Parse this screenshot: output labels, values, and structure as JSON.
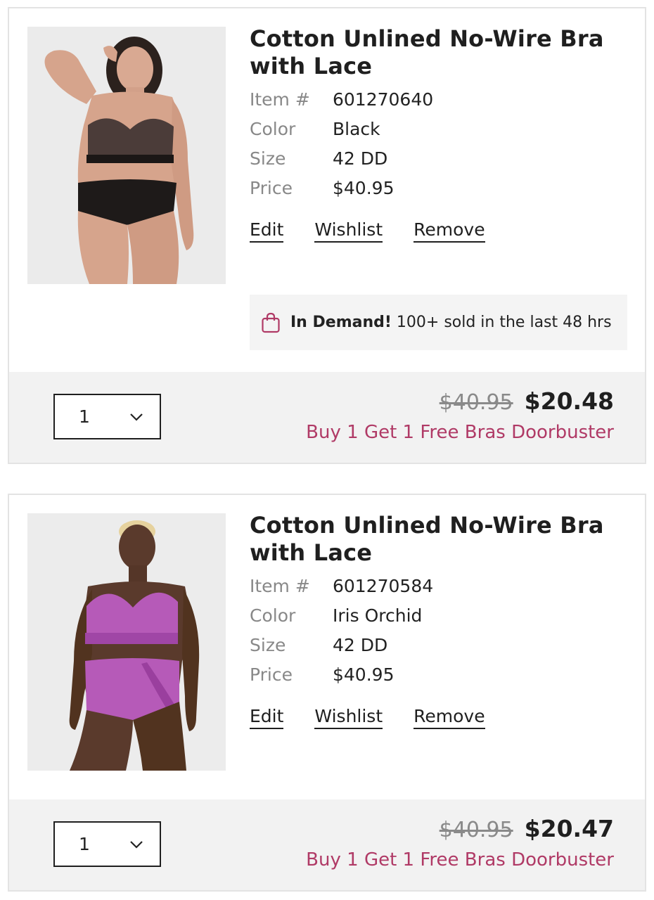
{
  "accent_color": "#b03a66",
  "items": [
    {
      "title": "Cotton Unlined No-Wire Bra with Lace",
      "item_label": "Item #",
      "item_number": "601270640",
      "color_label": "Color",
      "color_value": "Black",
      "size_label": "Size",
      "size_value": "42 DD",
      "price_label": "Price",
      "price_value": "$40.95",
      "actions": {
        "edit": "Edit",
        "wishlist": "Wishlist",
        "remove": "Remove"
      },
      "demand": {
        "strong": "In Demand!",
        "text": " 100+ sold in the last 48 hrs"
      },
      "quantity": "1",
      "original_price": "$40.95",
      "sale_price": "$20.48",
      "promo": "Buy 1 Get 1 Free Bras Doorbuster"
    },
    {
      "title": "Cotton Unlined No-Wire Bra with Lace",
      "item_label": "Item #",
      "item_number": "601270584",
      "color_label": "Color",
      "color_value": "Iris Orchid",
      "size_label": "Size",
      "size_value": "42 DD",
      "price_label": "Price",
      "price_value": "$40.95",
      "actions": {
        "edit": "Edit",
        "wishlist": "Wishlist",
        "remove": "Remove"
      },
      "quantity": "1",
      "original_price": "$40.95",
      "sale_price": "$20.47",
      "promo": "Buy 1 Get 1 Free Bras Doorbuster"
    }
  ]
}
